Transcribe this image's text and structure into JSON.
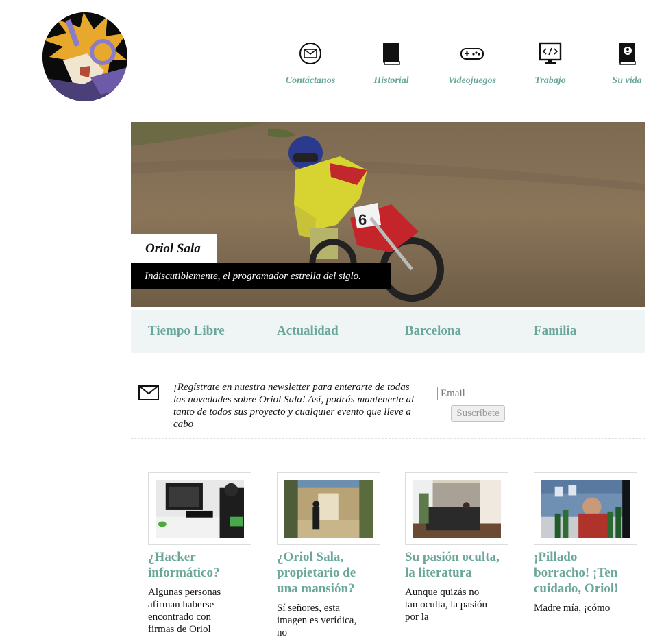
{
  "nav": {
    "items": [
      {
        "label": "Contáctanos",
        "icon": "envelope-icon"
      },
      {
        "label": "Historial",
        "icon": "book-icon"
      },
      {
        "label": "Videojuegos",
        "icon": "gamepad-icon"
      },
      {
        "label": "Trabajo",
        "icon": "code-monitor-icon"
      },
      {
        "label": "Su vida",
        "icon": "profile-book-icon"
      }
    ]
  },
  "hero": {
    "name": "Oriol Sala",
    "tagline": "Indiscutiblemente, el programador estrella del siglo."
  },
  "categories": [
    "Tiempo Libre",
    "Actualidad",
    "Barcelona",
    "Familia"
  ],
  "newsletter": {
    "text": "¡Regístrate en nuestra newsletter para enterarte de todas las novedades sobre Oriol Sala! Así, podrás mantenerte al tanto de todos sus proyecto y cualquier evento que lleve a cabo",
    "placeholder": "Email",
    "button": "Suscríbete"
  },
  "cards": [
    {
      "title": "¿Hacker informático?",
      "body": "Algunas personas afirman haberse encontrado con firmas de Oriol"
    },
    {
      "title": "¿Oriol Sala, propietario de una mansión?",
      "body": "Sí señores, esta imagen es verídica, no"
    },
    {
      "title": "Su pasión oculta, la literatura",
      "body": "Aunque quizás no tan oculta, la pasión por la"
    },
    {
      "title": "¡Pillado borracho! ¡Ten cuidado, Oriol!",
      "body": "Madre mía, ¡cómo"
    }
  ],
  "colors": {
    "accent": "#6aa79a",
    "band": "#eff5f4"
  }
}
